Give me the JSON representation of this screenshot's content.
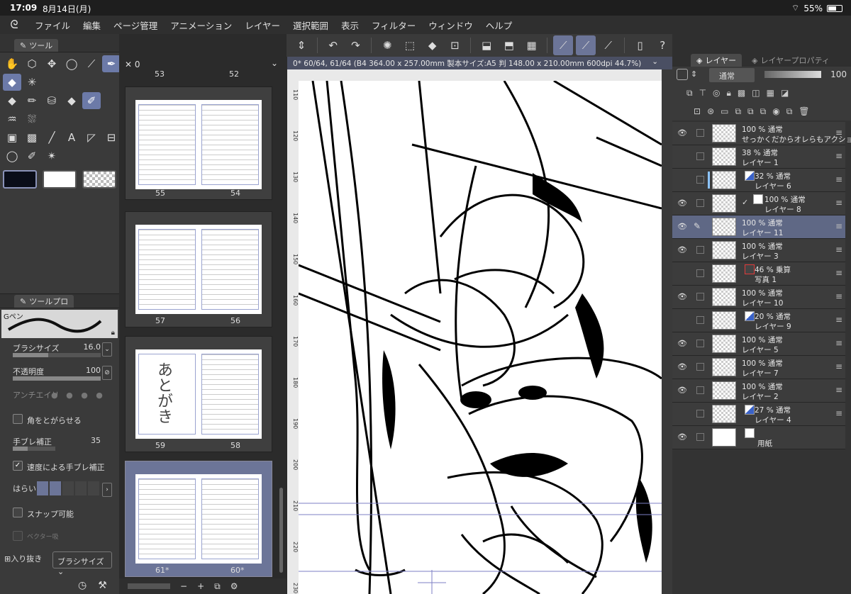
{
  "status_bar": {
    "time": "17:09",
    "date": "8月14日(月)",
    "battery": "55%",
    "battery_level": 0.55
  },
  "menu": {
    "logo_icon": "csp-logo-icon",
    "items": [
      "ファイル",
      "編集",
      "ページ管理",
      "アニメーション",
      "レイヤー",
      "選択範囲",
      "表示",
      "フィルター",
      "ウィンドウ",
      "ヘルプ"
    ]
  },
  "tool_panel": {
    "tab_label": "ツール"
  },
  "tool_property": {
    "tab_label": "ツールプロ",
    "brush_name": "Gペン",
    "brush_size_label": "ブラシサイズ",
    "brush_size_value": "16.0",
    "opacity_label": "不透明度",
    "opacity_value": "100",
    "antialias_label": "アンチエイリ",
    "sharp_corners_label": "角をとがらせる",
    "stabilization_label": "手ブレ補正",
    "stabilization_value": "35",
    "speed_stabilization_label": "速度による手ブレ補正",
    "taper_label": "はらい",
    "snap_label": "スナップ可能",
    "vector_label": "ベクター吸",
    "taper_in_label": "入り抜き",
    "taper_in_value": "ブラシサイズ"
  },
  "pages": {
    "search_value": "0",
    "top_numbers": [
      "53",
      "52"
    ],
    "spreads": [
      {
        "left": "55",
        "right": "54"
      },
      {
        "left": "57",
        "right": "56"
      },
      {
        "left": "59",
        "right": "58",
        "handwriting": "あとがき"
      },
      {
        "left": "61*",
        "right": "60*"
      }
    ],
    "bottom_controls": [
      "−",
      "+"
    ]
  },
  "canvas": {
    "info": "0* 60/64, 61/64 (B4 364.00 x 257.00mm 製本サイズ:A5 判 148.00 x 210.00mm 600dpi 44.7%)",
    "ruler_ticks": [
      "110",
      "120",
      "130",
      "140",
      "150",
      "160",
      "170",
      "180",
      "190",
      "200",
      "210",
      "220",
      "230"
    ]
  },
  "layer_panel": {
    "tab_layer": "レイヤー",
    "tab_property": "レイヤープロパティ",
    "blend_mode": "通常",
    "opacity": "100",
    "layers": [
      {
        "line1": "100 % 通常",
        "line2": "せっかくだからオレらもアクショ",
        "visible": true
      },
      {
        "line1": "38 % 通常",
        "line2": "レイヤー 1",
        "visible": false
      },
      {
        "line1": "32 % 通常",
        "line2": "レイヤー 6",
        "visible": false,
        "clip": true,
        "mask": true
      },
      {
        "line1": "100 % 通常",
        "line2": "レイヤー 8",
        "visible": true,
        "check": true
      },
      {
        "line1": "100 % 通常",
        "line2": "レイヤー 11",
        "visible": true,
        "selected": true
      },
      {
        "line1": "100 % 通常",
        "line2": "レイヤー 3",
        "visible": true
      },
      {
        "line1": "46 % 乗算",
        "line2": "写真 1",
        "visible": false,
        "red": true
      },
      {
        "line1": "100 % 通常",
        "line2": "レイヤー 10",
        "visible": true
      },
      {
        "line1": "20 % 通常",
        "line2": "レイヤー 9",
        "visible": false,
        "mask": true
      },
      {
        "line1": "100 % 通常",
        "line2": "レイヤー 5",
        "visible": true
      },
      {
        "line1": "100 % 通常",
        "line2": "レイヤー 7",
        "visible": true
      },
      {
        "line1": "100 % 通常",
        "line2": "レイヤー 2",
        "visible": true
      },
      {
        "line1": "27 % 通常",
        "line2": "レイヤー 4",
        "visible": false,
        "mask": true
      },
      {
        "line1": "",
        "line2": "用紙",
        "visible": true,
        "paper": true
      }
    ]
  }
}
